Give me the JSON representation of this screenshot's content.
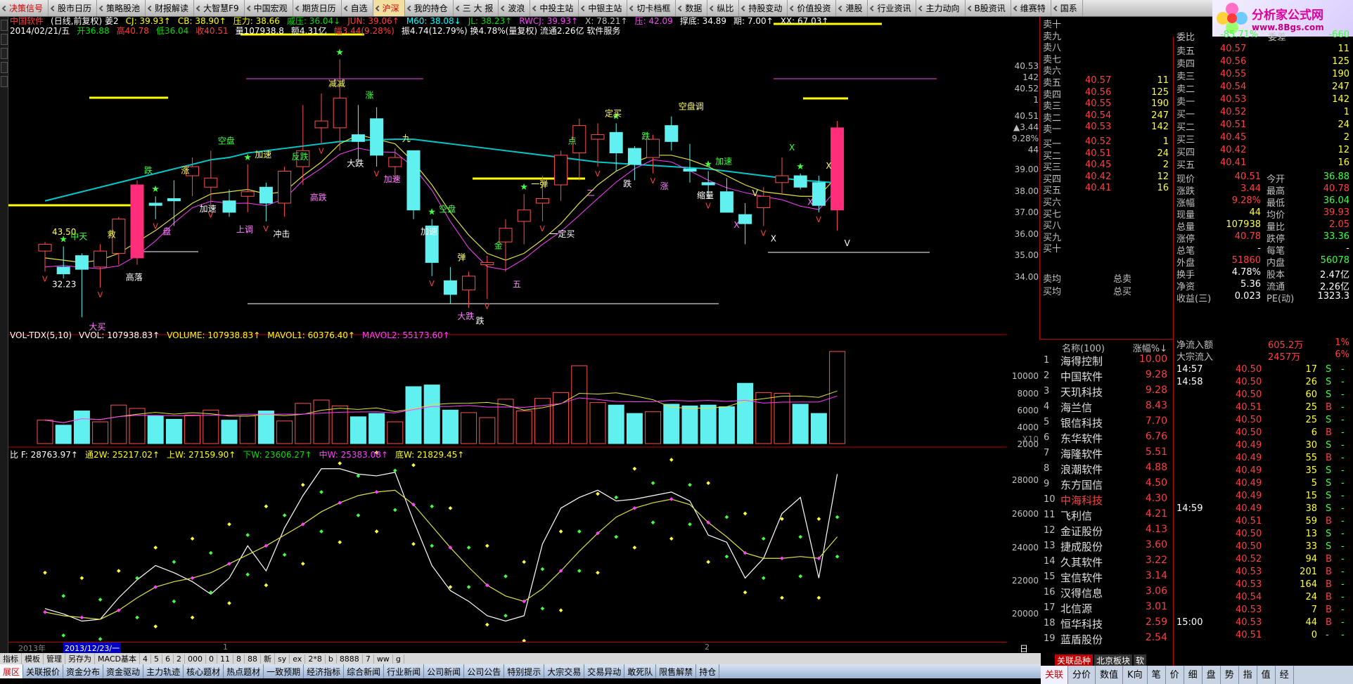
{
  "menu": {
    "items": [
      {
        "label": "决策信号",
        "red": true
      },
      {
        "label": "股市日历"
      },
      {
        "label": "策略股池"
      },
      {
        "label": "财报解读"
      },
      {
        "label": "大智慧F9"
      },
      {
        "label": "中国宏观"
      },
      {
        "label": "期货日历"
      },
      {
        "label": "自选"
      },
      {
        "label": "沪深",
        "active": true
      },
      {
        "label": "我的持仓"
      },
      {
        "label": "三 大 报"
      },
      {
        "label": "波浪"
      },
      {
        "label": "中投主站"
      },
      {
        "label": "中银主站"
      },
      {
        "label": "切卡档框"
      },
      {
        "label": "数据"
      },
      {
        "label": "纵比"
      },
      {
        "label": "持股变动"
      },
      {
        "label": "价值投资"
      },
      {
        "label": "港股"
      },
      {
        "label": "行业资讯"
      },
      {
        "label": "主力动向"
      },
      {
        "label": "B股资讯"
      },
      {
        "label": "维赛特"
      },
      {
        "label": "国系"
      }
    ]
  },
  "logo": {
    "title": "分析家公式网",
    "url": "www.8Bgs.com"
  },
  "chart": {
    "header1": [
      {
        "text": "中国软件",
        "cls": "r"
      },
      {
        "text": "(日线,前复权) 姜2",
        "cls": "w"
      },
      {
        "text": "CJ: 39.93↑",
        "cls": "y"
      },
      {
        "text": "CB: 38.90↑",
        "cls": "y"
      },
      {
        "text": "压力: 38.66",
        "cls": "y"
      },
      {
        "text": "戚压: 36.04↓",
        "cls": "g"
      },
      {
        "text": "JUN: 39.06↑",
        "cls": "r"
      },
      {
        "text": "M60: 38.08↓",
        "cls": "c"
      },
      {
        "text": "JL: 38.23↑",
        "cls": "g"
      },
      {
        "text": "RWCJ: 39.93↑",
        "cls": "m"
      },
      {
        "text": "X: 78.21↑",
        "cls": "gr"
      },
      {
        "text": "压: 42.09",
        "cls": "m"
      },
      {
        "text": "撑底: 34.89",
        "cls": "w"
      },
      {
        "text": "期: 7.00↑",
        "cls": "w"
      },
      {
        "text": "XX: 67.03↑",
        "cls": "w"
      }
    ],
    "header2": [
      {
        "text": "2014/02/21/五",
        "cls": "w"
      },
      {
        "text": "开36.88",
        "cls": "g"
      },
      {
        "text": "高40.78",
        "cls": "r"
      },
      {
        "text": "低36.04",
        "cls": "g"
      },
      {
        "text": "收40.51",
        "cls": "r"
      },
      {
        "text": "量107938.8",
        "cls": "w"
      },
      {
        "text": "额4.31亿",
        "cls": "w"
      },
      {
        "text": "幅3.44(9.28%)",
        "cls": "r"
      },
      {
        "text": "振4.74(12.79%) 换4.78%(量复权) 流通2.26亿 软件服务",
        "cls": "w"
      }
    ],
    "vol_header": [
      {
        "text": "VOL-TDX(5,10)",
        "cls": "w"
      },
      {
        "text": "VVOL: 107938.83↑",
        "cls": "w"
      },
      {
        "text": "VOLUME: 107938.83↑",
        "cls": "y"
      },
      {
        "text": "MAVOL1: 60376.40↑",
        "cls": "y"
      },
      {
        "text": "MAVOL2: 55173.60↑",
        "cls": "m"
      }
    ],
    "ind_header": [
      {
        "text": "比 F: 28763.97↑",
        "cls": "w"
      },
      {
        "text": "通2W: 25217.02↑",
        "cls": "y"
      },
      {
        "text": "上W: 27159.90↑",
        "cls": "y"
      },
      {
        "text": "下W: 23606.27↑",
        "cls": "g"
      },
      {
        "text": "中W: 25383.08↑",
        "cls": "m"
      },
      {
        "text": "底W: 21829.45↑",
        "cls": "y"
      }
    ],
    "price_axis": [
      "40.53",
      "142",
      "40.52",
      "1",
      "40.51",
      "▲3.44",
      "9.28%",
      "44",
      "39.00",
      "38.00",
      "37.00",
      "36.00",
      "35.00",
      "34.00"
    ],
    "vol_axis": [
      "10000",
      "8000",
      "6000",
      "4000",
      "2000"
    ],
    "vol_unit": "X10",
    "ind_axis": [
      "28000",
      "26000",
      "24000",
      "22000",
      "20000"
    ],
    "annotations": [
      "43.50",
      "32.23",
      "中天",
      "大买",
      "救",
      "高落",
      "跌",
      "盘",
      "涨",
      "加速",
      "空盘",
      "上调",
      "加速",
      "冲击",
      "反跌",
      "高跌",
      "减减",
      "大跌",
      "涨",
      "加速",
      "九",
      "加速",
      "空盘",
      "大跌",
      "弹",
      "跌",
      "金",
      "五",
      "一弹",
      "一定买",
      "点",
      "二",
      "定买",
      "跌",
      "跌",
      "涨",
      "空盘调",
      "缩量",
      "加速",
      "X",
      "V",
      "X",
      "X",
      "X",
      "X",
      "V"
    ],
    "period": "日线",
    "dates": [
      "2013年",
      "2013/12/23/一",
      "1",
      "2"
    ]
  },
  "toolrow": [
    "指标",
    "模板",
    "管理",
    "另存为",
    "MACD基本",
    "4",
    "5",
    "6",
    "2",
    "000",
    "0",
    "11",
    "8",
    "88",
    "新",
    "sy",
    "ex",
    "2*8",
    "b",
    "8888",
    "7",
    "ww",
    "g"
  ],
  "tabrow": [
    "展区",
    "关联报价",
    "资金分布",
    "资金驱动",
    "主力轨迹",
    "核心题材",
    "热点题材",
    "一致预期",
    "经济指标",
    "综合新闻",
    "行业新闻",
    "公司新闻",
    "公司公告",
    "特别提示",
    "大宗交易",
    "交易异动",
    "敢死队",
    "限售解禁",
    "持仓"
  ],
  "book": {
    "sell": [
      {
        "label": "卖十",
        "price": "",
        "vol": ""
      },
      {
        "label": "卖九",
        "price": "",
        "vol": ""
      },
      {
        "label": "卖八",
        "price": "",
        "vol": ""
      },
      {
        "label": "卖七",
        "price": "",
        "vol": ""
      },
      {
        "label": "卖六",
        "price": "",
        "vol": ""
      },
      {
        "label": "卖五",
        "price": "40.57",
        "vol": "11"
      },
      {
        "label": "卖四",
        "price": "40.56",
        "vol": "125"
      },
      {
        "label": "卖三",
        "price": "40.55",
        "vol": "190"
      },
      {
        "label": "卖二",
        "price": "40.54",
        "vol": "247"
      },
      {
        "label": "卖一",
        "price": "40.53",
        "vol": "142"
      }
    ],
    "buy": [
      {
        "label": "买一",
        "price": "40.52",
        "vol": "1"
      },
      {
        "label": "买二",
        "price": "40.51",
        "vol": "24"
      },
      {
        "label": "买三",
        "price": "40.45",
        "vol": "2"
      },
      {
        "label": "买四",
        "price": "40.42",
        "vol": "12"
      },
      {
        "label": "买五",
        "price": "40.41",
        "vol": "16"
      },
      {
        "label": "买六",
        "price": "",
        "vol": ""
      },
      {
        "label": "买七",
        "price": "",
        "vol": ""
      },
      {
        "label": "买八",
        "price": "",
        "vol": ""
      },
      {
        "label": "买九",
        "price": "",
        "vol": ""
      },
      {
        "label": "买十",
        "price": "",
        "vol": ""
      }
    ],
    "avg_sell": "卖均",
    "total_sell": "总卖",
    "avg_buy": "买均",
    "total_buy": "总买"
  },
  "stocklist": {
    "head_name": "名称(100)",
    "head_chg": "涨幅%↓",
    "rows": [
      {
        "n": "1",
        "name": "海得控制",
        "chg": "10.00"
      },
      {
        "n": "2",
        "name": "中国软件",
        "chg": "9.28"
      },
      {
        "n": "3",
        "name": "天玑科技",
        "chg": "9.28"
      },
      {
        "n": "4",
        "name": "海兰信",
        "chg": "8.43"
      },
      {
        "n": "5",
        "name": "银信科技",
        "chg": "7.70"
      },
      {
        "n": "6",
        "name": "东华软件",
        "chg": "6.76"
      },
      {
        "n": "7",
        "name": "海隆软件",
        "chg": "5.51"
      },
      {
        "n": "8",
        "name": "浪潮软件",
        "chg": "4.88"
      },
      {
        "n": "9",
        "name": "东方国信",
        "chg": "4.50"
      },
      {
        "n": "10",
        "name": "中海科技",
        "chg": "4.30",
        "hl": true
      },
      {
        "n": "11",
        "name": "飞利信",
        "chg": "4.21"
      },
      {
        "n": "12",
        "name": "金证股份",
        "chg": "4.13"
      },
      {
        "n": "13",
        "name": "捷成股份",
        "chg": "3.60"
      },
      {
        "n": "14",
        "name": "久其软件",
        "chg": "3.22"
      },
      {
        "n": "15",
        "name": "宝信软件",
        "chg": "3.14"
      },
      {
        "n": "16",
        "name": "汉得信息",
        "chg": "3.06"
      },
      {
        "n": "17",
        "name": "北信源",
        "chg": "3.01"
      },
      {
        "n": "18",
        "name": "恒华科技",
        "chg": "2.59"
      },
      {
        "n": "19",
        "name": "蓝盾股份",
        "chg": "2.54"
      }
    ],
    "tabs": [
      "关联品种",
      "北京板块",
      "软"
    ]
  },
  "quote": {
    "weibi": {
      "label": "委比",
      "val": "-85.71%",
      "label2": "委差",
      "val2": "-660"
    },
    "sell": [
      {
        "label": "卖五",
        "price": "40.57",
        "vol": "11"
      },
      {
        "label": "卖四",
        "price": "40.56",
        "vol": "125"
      },
      {
        "label": "卖三",
        "price": "40.55",
        "vol": "190"
      },
      {
        "label": "卖二",
        "price": "40.54",
        "vol": "247"
      },
      {
        "label": "卖一",
        "price": "40.53",
        "vol": "142"
      }
    ],
    "buy": [
      {
        "label": "买一",
        "price": "40.52",
        "vol": "1"
      },
      {
        "label": "买二",
        "price": "40.51",
        "vol": "24"
      },
      {
        "label": "买三",
        "price": "40.45",
        "vol": "2"
      },
      {
        "label": "买四",
        "price": "40.42",
        "vol": "12"
      },
      {
        "label": "买五",
        "price": "40.41",
        "vol": "16"
      }
    ],
    "stats": [
      {
        "a": "现价",
        "av": "40.51",
        "ac": "r",
        "b": "今开",
        "bv": "36.88",
        "bc": "g"
      },
      {
        "a": "涨跌",
        "av": "3.44",
        "ac": "r",
        "b": "最高",
        "bv": "40.78",
        "bc": "r"
      },
      {
        "a": "涨幅",
        "av": "9.28%",
        "ac": "r",
        "b": "最低",
        "bv": "36.04",
        "bc": "g"
      },
      {
        "a": "现量",
        "av": "44",
        "ac": "y",
        "b": "均价",
        "bv": "39.93",
        "bc": "r"
      },
      {
        "a": "总量",
        "av": "107938",
        "ac": "y",
        "b": "量比",
        "bv": "2.05",
        "bc": "r"
      },
      {
        "a": "涨停",
        "av": "40.78",
        "ac": "r",
        "b": "跌停",
        "bv": "33.36",
        "bc": "g"
      },
      {
        "a": "总笔",
        "av": "-",
        "ac": "w",
        "b": "每笔",
        "bv": "-",
        "bc": "w"
      },
      {
        "a": "外盘",
        "av": "51860",
        "ac": "r",
        "b": "内盘",
        "bv": "56078",
        "bc": "g"
      },
      {
        "a": "换手",
        "av": "4.78%",
        "ac": "w",
        "b": "股本",
        "bv": "2.47亿",
        "bc": "w"
      },
      {
        "a": "净资",
        "av": "5.36",
        "ac": "w",
        "b": "流通",
        "bv": "2.26亿",
        "bc": "w"
      },
      {
        "a": "收益(三)",
        "av": "0.023",
        "ac": "w",
        "b": "PE(动)",
        "bv": "1323.3",
        "bc": "w"
      }
    ],
    "flow": [
      {
        "label": "净流入额",
        "val": "605.2万",
        "pct": "1%"
      },
      {
        "label": "大宗流入",
        "val": "2457万",
        "pct": "6%"
      }
    ],
    "ticks": [
      {
        "t": "14:57",
        "p": "40.50",
        "v": "17",
        "s": "S"
      },
      {
        "t": "14:58",
        "p": "40.50",
        "v": "26",
        "s": "S"
      },
      {
        "t": "",
        "p": "40.50",
        "v": "60",
        "s": "S"
      },
      {
        "t": "",
        "p": "40.51",
        "v": "25",
        "s": "B"
      },
      {
        "t": "",
        "p": "40.50",
        "v": "25",
        "s": "S"
      },
      {
        "t": "",
        "p": "40.50",
        "v": "6",
        "s": "B"
      },
      {
        "t": "",
        "p": "40.49",
        "v": "30",
        "s": "S"
      },
      {
        "t": "",
        "p": "40.49",
        "v": "55",
        "s": "B"
      },
      {
        "t": "",
        "p": "40.49",
        "v": "35",
        "s": "S"
      },
      {
        "t": "",
        "p": "40.49",
        "v": "5",
        "s": "S"
      },
      {
        "t": "",
        "p": "40.49",
        "v": "15",
        "s": "S"
      },
      {
        "t": "14:59",
        "p": "40.49",
        "v": "38",
        "s": "S"
      },
      {
        "t": "",
        "p": "40.51",
        "v": "59",
        "s": "B"
      },
      {
        "t": "",
        "p": "40.50",
        "v": "13",
        "s": "S"
      },
      {
        "t": "",
        "p": "40.50",
        "v": "33",
        "s": "S"
      },
      {
        "t": "",
        "p": "40.52",
        "v": "94",
        "s": "B"
      },
      {
        "t": "",
        "p": "40.53",
        "v": "201",
        "s": "B"
      },
      {
        "t": "",
        "p": "40.53",
        "v": "164",
        "s": "B"
      },
      {
        "t": "",
        "p": "40.54",
        "v": "24",
        "s": "B"
      },
      {
        "t": "",
        "p": "40.53",
        "v": "7",
        "s": "B"
      },
      {
        "t": "15:00",
        "p": "40.53",
        "v": "44",
        "s": "B"
      },
      {
        "t": "",
        "p": "40.51",
        "v": "0",
        "s": "-"
      }
    ],
    "tabs": [
      "关联",
      "分价",
      "数值",
      "K向",
      "笔",
      "价",
      "细",
      "盘",
      "势",
      "指",
      "值",
      "经"
    ]
  },
  "candles": {
    "ohlc": [
      [
        35.1,
        35.5,
        34.2,
        35.4
      ],
      [
        34.4,
        35.3,
        33.9,
        34.1
      ],
      [
        34.9,
        35.0,
        32.2,
        34.3
      ],
      [
        34.4,
        35.4,
        33.5,
        35.1
      ],
      [
        35.0,
        36.6,
        34.5,
        36.5
      ],
      [
        34.8,
        38.2,
        34.5,
        38.0
      ],
      [
        37.2,
        37.5,
        36.5,
        37.1
      ],
      [
        37.4,
        38.2,
        36.2,
        37.3
      ],
      [
        38.4,
        39.2,
        37.5,
        38.8
      ],
      [
        37.9,
        39.5,
        37.0,
        38.3
      ],
      [
        37.3,
        37.8,
        36.6,
        36.8
      ],
      [
        37.5,
        38.9,
        36.8,
        37.7
      ],
      [
        37.9,
        38.1,
        36.4,
        37.2
      ],
      [
        37.2,
        38.8,
        36.6,
        38.6
      ],
      [
        38.8,
        41.5,
        38.0,
        39.5
      ],
      [
        40.5,
        42.0,
        39.8,
        40.8
      ],
      [
        40.5,
        43.5,
        39.5,
        41.8
      ],
      [
        40.2,
        41.5,
        39.0,
        39.9
      ],
      [
        40.9,
        41.4,
        38.8,
        39.3
      ],
      [
        38.8,
        39.6,
        38.2,
        39.2
      ],
      [
        39.5,
        39.5,
        36.5,
        36.9
      ],
      [
        36.2,
        36.5,
        34.0,
        34.6
      ],
      [
        33.8,
        34.4,
        32.8,
        33.2
      ],
      [
        33.4,
        34.2,
        32.6,
        34.0
      ],
      [
        34.5,
        34.9,
        33.0,
        34.6
      ],
      [
        35.5,
        36.5,
        34.2,
        36.1
      ],
      [
        36.4,
        37.6,
        35.4,
        36.9
      ],
      [
        37.2,
        38.4,
        36.4,
        37.4
      ],
      [
        38.0,
        39.5,
        37.3,
        39.3
      ],
      [
        39.4,
        40.9,
        38.2,
        40.6
      ],
      [
        40.0,
        40.7,
        38.8,
        40.2
      ],
      [
        40.3,
        40.7,
        38.6,
        39.4
      ],
      [
        39.6,
        39.7,
        38.2,
        38.9
      ],
      [
        39.2,
        40.2,
        38.5,
        40.0
      ],
      [
        40.6,
        41.0,
        39.5,
        39.9
      ],
      [
        38.7,
        39.8,
        38.1,
        38.6
      ],
      [
        38.1,
        38.6,
        37.4,
        38.0
      ],
      [
        37.7,
        38.3,
        36.8,
        36.8
      ],
      [
        36.7,
        37.2,
        35.4,
        36.3
      ],
      [
        37.0,
        37.9,
        36.2,
        37.5
      ],
      [
        38.1,
        39.2,
        37.6,
        38.4
      ],
      [
        38.4,
        38.5,
        37.8,
        37.9
      ],
      [
        38.1,
        38.4,
        36.8,
        37.1
      ],
      [
        36.9,
        40.8,
        36.0,
        40.5
      ]
    ],
    "ma_cyan": [
      37.3,
      37.5,
      37.7,
      37.9,
      38.1,
      38.3,
      38.5,
      38.7,
      38.9,
      39.1,
      39.2,
      39.4,
      39.5,
      39.6,
      39.7,
      39.8,
      39.9,
      39.95,
      39.98,
      40.0,
      40.0,
      39.9,
      39.8,
      39.7,
      39.6,
      39.5,
      39.4,
      39.3,
      39.2,
      39.1,
      39.0,
      38.95,
      38.9,
      38.85,
      38.8,
      38.75,
      38.7,
      38.6,
      38.5,
      38.4,
      38.3,
      38.2,
      38.15,
      38.08
    ],
    "ma_yellow": [
      34.8,
      34.7,
      34.6,
      34.7,
      35.0,
      35.5,
      36.0,
      36.6,
      37.2,
      37.6,
      37.7,
      37.8,
      37.6,
      37.7,
      38.4,
      39.0,
      39.8,
      40.2,
      40.0,
      39.8,
      39.0,
      38.0,
      36.8,
      35.8,
      35.0,
      34.7,
      35.0,
      35.6,
      36.3,
      37.2,
      38.0,
      38.6,
      39.0,
      39.3,
      39.3,
      39.1,
      38.8,
      38.4,
      38.0,
      37.7,
      37.6,
      37.5,
      37.5,
      38.4
    ],
    "vols": [
      2800,
      2200,
      3900,
      2600,
      4600,
      4200,
      3300,
      2900,
      3400,
      4000,
      2800,
      3300,
      3900,
      2700,
      4800,
      5200,
      4500,
      3200,
      3600,
      2600,
      6800,
      7000,
      4000,
      3700,
      3100,
      5300,
      3900,
      5400,
      6100,
      9300,
      4900,
      4600,
      3600,
      3800,
      4700,
      4500,
      4600,
      4400,
      7200,
      6100,
      6000,
      4700,
      3600,
      11000
    ],
    "ind_f": [
      21200,
      20900,
      20500,
      20600,
      21800,
      22800,
      23600,
      23200,
      22700,
      22000,
      22900,
      24700,
      23300,
      25700,
      27500,
      29000,
      29000,
      28700,
      28600,
      28800,
      26100,
      23600,
      22200,
      21600,
      20800,
      20500,
      20800,
      24800,
      26800,
      27400,
      27800,
      27200,
      27300,
      27500,
      27700,
      27200,
      25300,
      24900,
      22900,
      24000,
      26500,
      27400,
      22900,
      28700
    ],
    "ind_mid": [
      21000,
      20800,
      20700,
      20600,
      21100,
      21800,
      22400,
      22700,
      22900,
      23200,
      23700,
      24200,
      24700,
      25300,
      25900,
      26600,
      27100,
      27500,
      27700,
      27800,
      27000,
      25800,
      24600,
      23500,
      22500,
      21900,
      21600,
      22300,
      23300,
      24400,
      25400,
      26300,
      26800,
      27100,
      27300,
      27000,
      26000,
      25200,
      24300,
      24000,
      24000,
      24100,
      24000,
      25200
    ]
  }
}
